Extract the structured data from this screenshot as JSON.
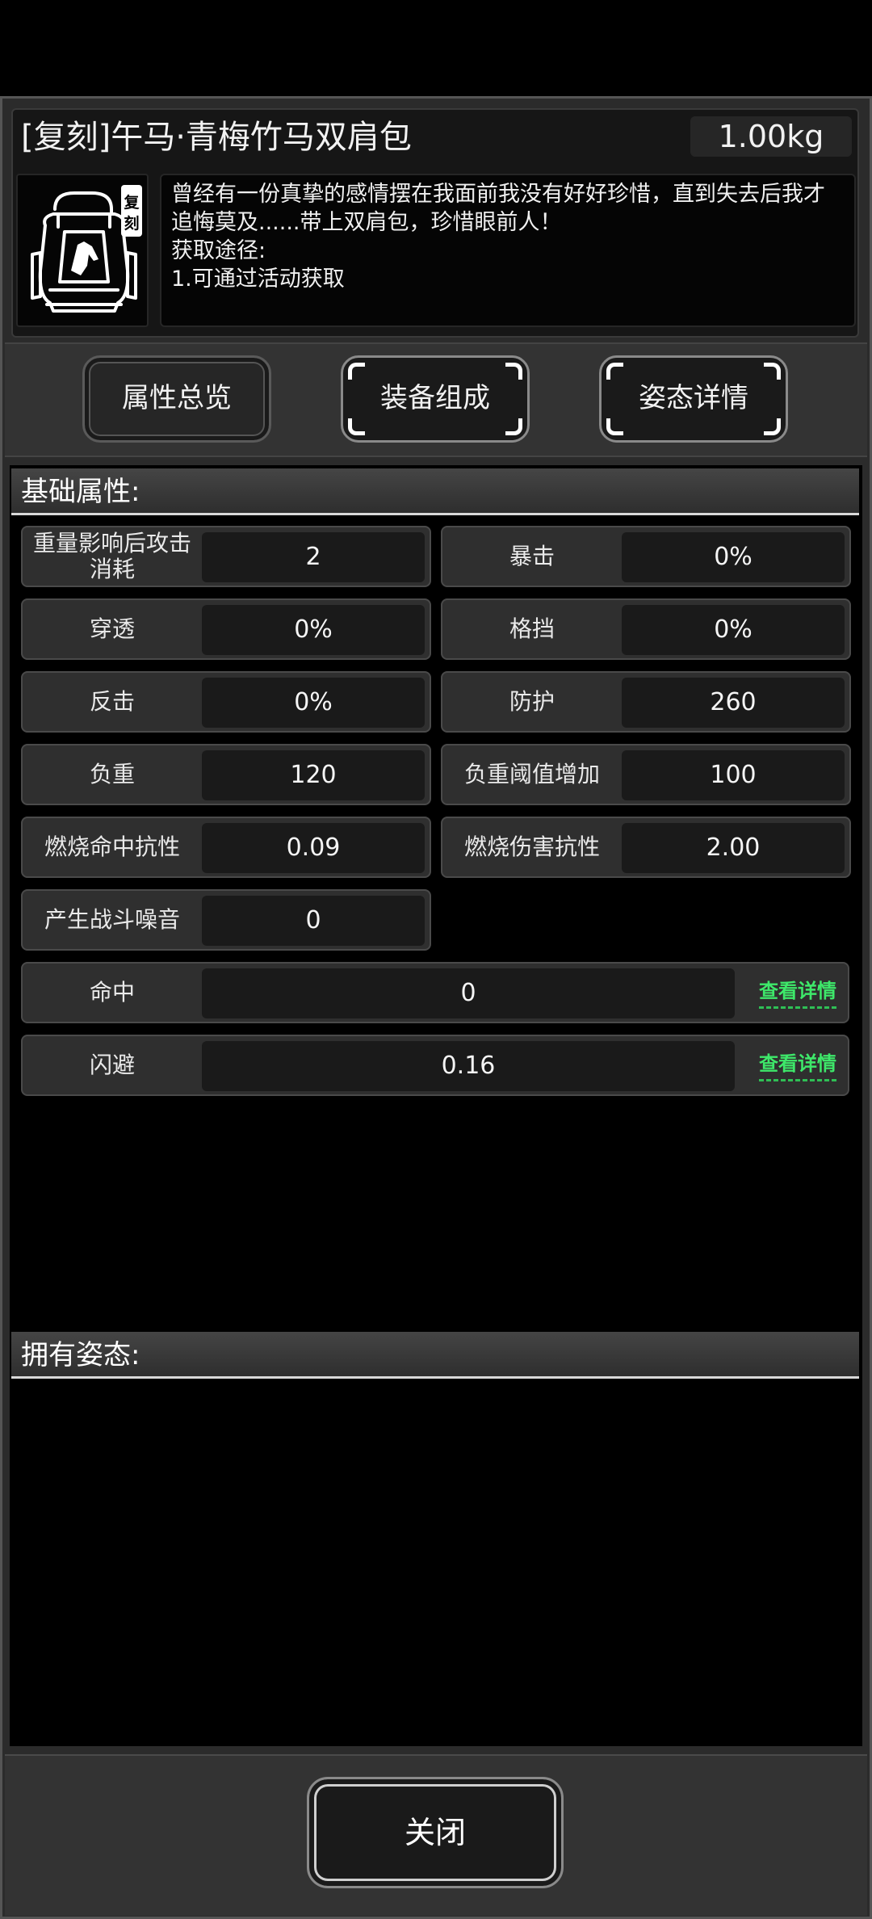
{
  "item": {
    "name": "[复刻]午马·青梅竹马双肩包",
    "weight": "1.00kg",
    "badge": "复刻",
    "description": "曾经有一份真挚的感情摆在我面前我没有好好珍惜，直到失去后我才追悔莫及......带上双肩包，珍惜眼前人！\n获取途径:\n1.可通过活动获取",
    "icon": "backpack-icon"
  },
  "tabs": [
    {
      "label": "属性总览",
      "active": true
    },
    {
      "label": "装备组成",
      "active": false
    },
    {
      "label": "姿态详情",
      "active": false
    }
  ],
  "basic_section": {
    "title": "基础属性:"
  },
  "stats": [
    {
      "label": "重量影响后攻击消耗",
      "value": "2"
    },
    {
      "label": "暴击",
      "value": "0%"
    },
    {
      "label": "穿透",
      "value": "0%"
    },
    {
      "label": "格挡",
      "value": "0%"
    },
    {
      "label": "反击",
      "value": "0%"
    },
    {
      "label": "防护",
      "value": "260"
    },
    {
      "label": "负重",
      "value": "120"
    },
    {
      "label": "负重阈值增加",
      "value": "100"
    },
    {
      "label": "燃烧命中抗性",
      "value": "0.09"
    },
    {
      "label": "燃烧伤害抗性",
      "value": "2.00"
    },
    {
      "label": "产生战斗噪音",
      "value": "0"
    }
  ],
  "wide_stats": [
    {
      "label": "命中",
      "value": "0",
      "detail": "查看详情"
    },
    {
      "label": "闪避",
      "value": "0.16",
      "detail": "查看详情"
    }
  ],
  "stance_section": {
    "title": "拥有姿态:"
  },
  "close_label": "关闭",
  "colors": {
    "accent_green": "#3ee86a",
    "panel": "#2f2f2f",
    "background": "#000000"
  }
}
